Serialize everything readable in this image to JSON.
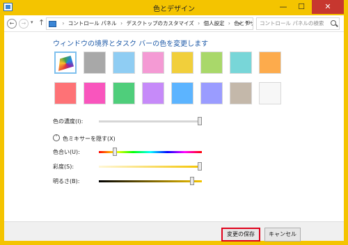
{
  "window": {
    "title": "色とデザイン",
    "minimize": "—",
    "maximize": "☐",
    "close": "✕"
  },
  "nav": {
    "back": "←",
    "forward": "→",
    "dropdown": "▾",
    "up": "↑",
    "breadcrumb": [
      "コントロール パネル",
      "デスクトップのカスタマイズ",
      "個人設定",
      "色とデザイン"
    ],
    "separator": "›",
    "caret": "▾",
    "refresh": "↻",
    "search_placeholder": "コントロール パネルの検索"
  },
  "heading": "ウィンドウの境界とタスク バーの色を変更します",
  "colors": {
    "row1": [
      "#ffffff",
      "#a8a8a8",
      "#8fcdf3",
      "#f49ad4",
      "#f1cf3b",
      "#a9d86a",
      "#78d6d8",
      "#fdab4c"
    ],
    "row2": [
      "#fe7276",
      "#f955bd",
      "#4fce7b",
      "#c68af9",
      "#5cb4ff",
      "#9a9cff",
      "#c4b8aa",
      "#f7f7f7"
    ],
    "selected_index": 0,
    "selected_icon": "rainbow-palette-icon"
  },
  "intensity": {
    "label": "色の濃度(I):",
    "value": 1.0
  },
  "mixer": {
    "toggle_icon": "chevron-up-icon",
    "toggle_glyph": "ˆ",
    "label": "色ミキサーを隠す(X)"
  },
  "hue": {
    "label": "色合い(U):",
    "value": 0.14
  },
  "saturation": {
    "label": "彩度(S):",
    "value": 1.0
  },
  "brightness": {
    "label": "明るさ(B):",
    "value": 0.92
  },
  "buttons": {
    "save": "変更の保存",
    "cancel": "キャンセル"
  }
}
